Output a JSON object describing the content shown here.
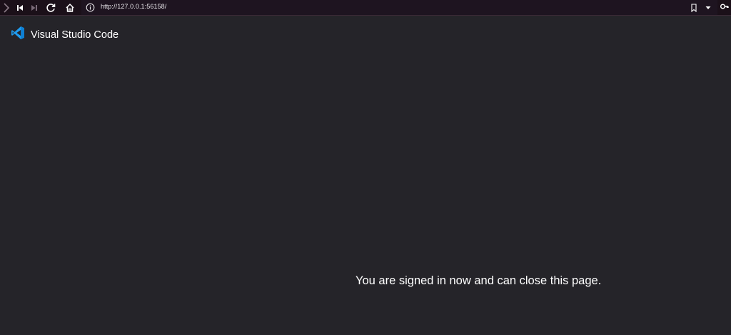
{
  "browser": {
    "url": "http://127.0.0.1:56158/",
    "icons": {
      "sidebar_toggle": "chevron-right-icon",
      "back": "skip-back-icon",
      "forward": "skip-forward-icon",
      "reload": "reload-icon",
      "home": "home-icon",
      "site_info": "info-icon",
      "bookmark": "bookmark-icon",
      "dropdown": "caret-down-icon",
      "search": "search-key-icon"
    }
  },
  "page": {
    "brand_name": "Visual Studio Code",
    "message": "You are signed in now and can close this page."
  },
  "colors": {
    "background": "#252429",
    "toolbar": "#1b1019",
    "vscode_blue": "#1f9cf0",
    "text": "#ffffff"
  }
}
